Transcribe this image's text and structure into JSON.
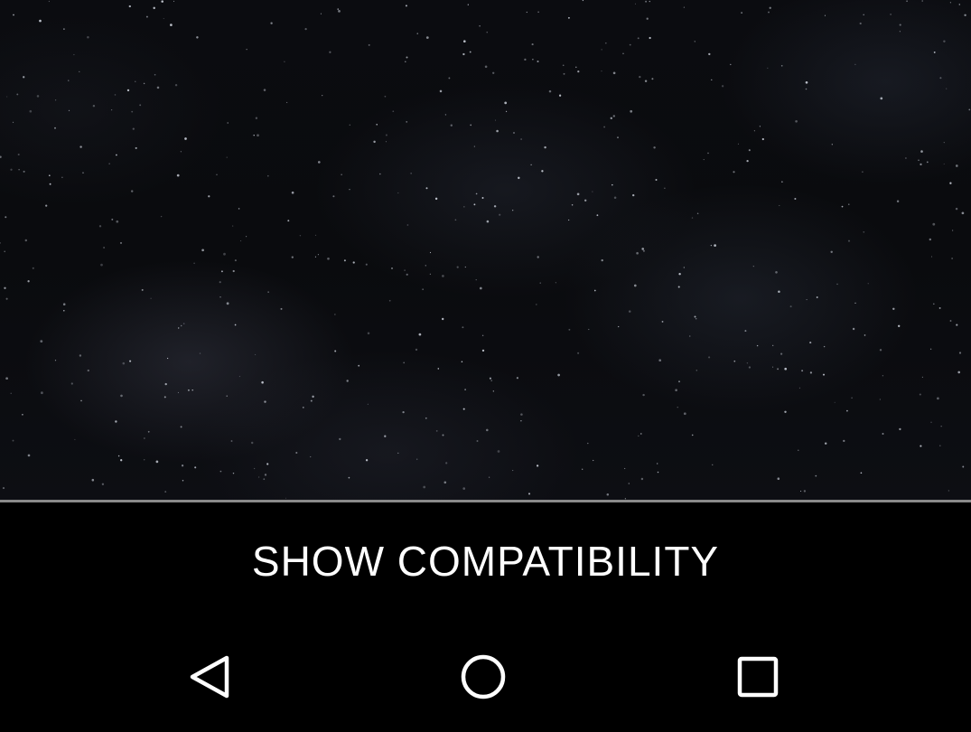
{
  "screen": {
    "background_color": "#000000"
  },
  "wallpaper": {
    "description_icon": "starfield-wallpaper"
  },
  "action_bar": {
    "button_label": "SHOW COMPATIBILITY",
    "text_color": "#ffffff"
  },
  "navigation": {
    "back_icon": "triangle-back-icon",
    "home_icon": "circle-home-icon",
    "recents_icon": "square-recents-icon",
    "icon_color": "#ffffff"
  }
}
